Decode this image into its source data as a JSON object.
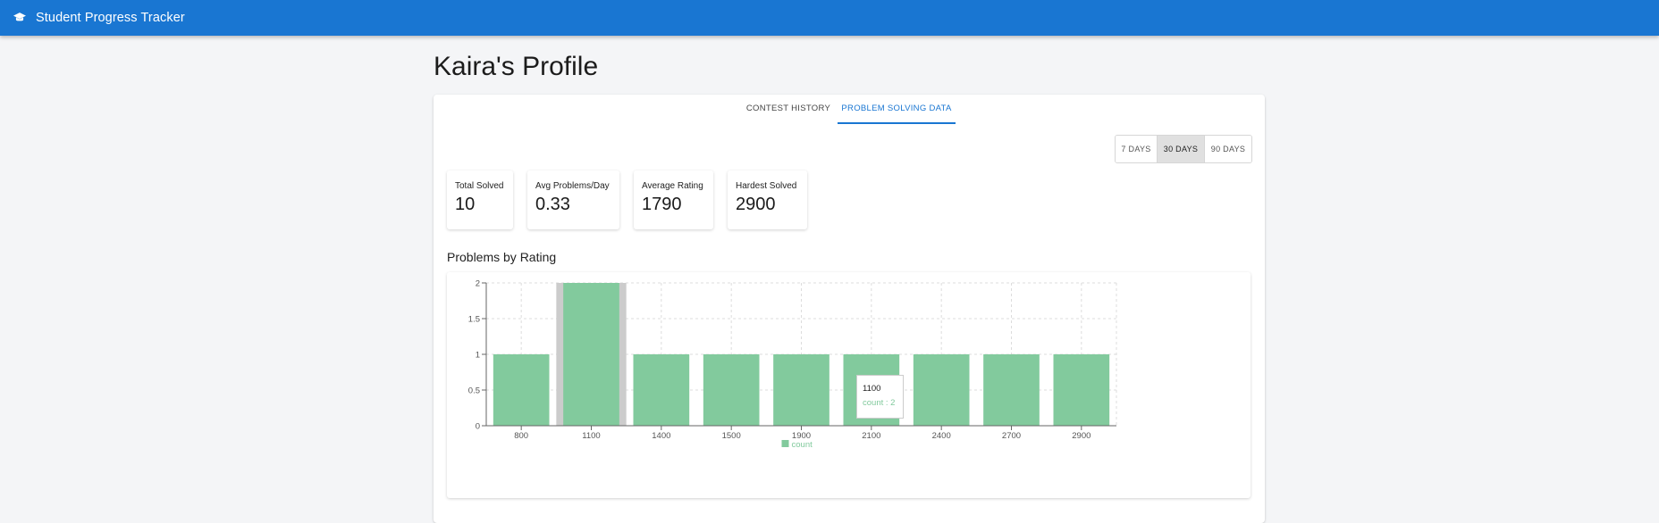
{
  "appbar": {
    "title": "Student Progress Tracker",
    "icon": "graduation-cap-icon",
    "color": "#1976d2"
  },
  "page": {
    "title": "Kaira's Profile"
  },
  "tabs": [
    {
      "label": "CONTEST HISTORY",
      "active": false
    },
    {
      "label": "PROBLEM SOLVING DATA",
      "active": true
    }
  ],
  "range": {
    "options": [
      "7 DAYS",
      "30 DAYS",
      "90 DAYS"
    ],
    "selected": "30 DAYS"
  },
  "stats": [
    {
      "label": "Total Solved",
      "value": "10"
    },
    {
      "label": "Avg Problems/Day",
      "value": "0.33"
    },
    {
      "label": "Average Rating",
      "value": "1790"
    },
    {
      "label": "Hardest Solved",
      "value": "2900"
    }
  ],
  "chart_section": {
    "title": "Problems by Rating"
  },
  "chart_data": {
    "type": "bar",
    "categories": [
      "800",
      "1100",
      "1400",
      "1500",
      "1900",
      "2100",
      "2400",
      "2700",
      "2900"
    ],
    "series": [
      {
        "name": "count",
        "values": [
          1,
          2,
          1,
          1,
          1,
          1,
          1,
          1,
          1
        ],
        "color": "#82ca9d"
      }
    ],
    "ylim": [
      0,
      2
    ],
    "yticks": [
      "0",
      "0.5",
      "1",
      "1.5",
      "2"
    ],
    "grid": true,
    "legend": "bottom",
    "highlighted_category": "1100"
  },
  "tooltip": {
    "label": "1100",
    "value_text": "count : 2"
  }
}
